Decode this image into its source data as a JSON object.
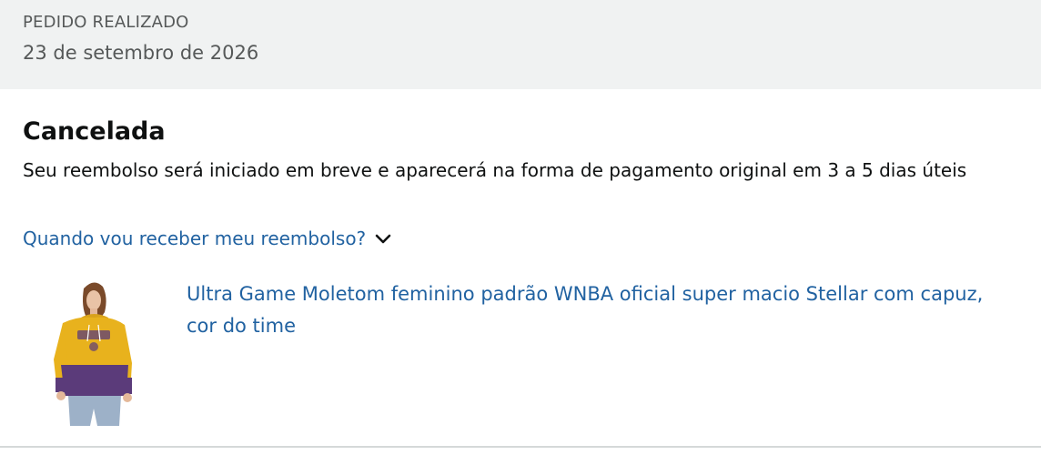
{
  "order": {
    "placed_label": "PEDIDO REALIZADO",
    "placed_date": "23 de setembro de 2026"
  },
  "status": {
    "title": "Cancelada",
    "message": "Seu reembolso será iniciado em breve e aparecerá na forma de pagamento original em 3 a 5 dias úteis",
    "refund_link": "Quando vou receber meu reembolso?"
  },
  "product": {
    "title": "Ultra Game Moletom feminino padrão WNBA oficial super macio Stellar com capuz, cor do time",
    "image_icon": "hoodie-product-image"
  },
  "colors": {
    "link": "#2162a1",
    "header_bg": "#f0f2f2",
    "muted_text": "#565959",
    "hoodie_yellow": "#e8b21d",
    "hoodie_purple": "#5b3b7a"
  }
}
